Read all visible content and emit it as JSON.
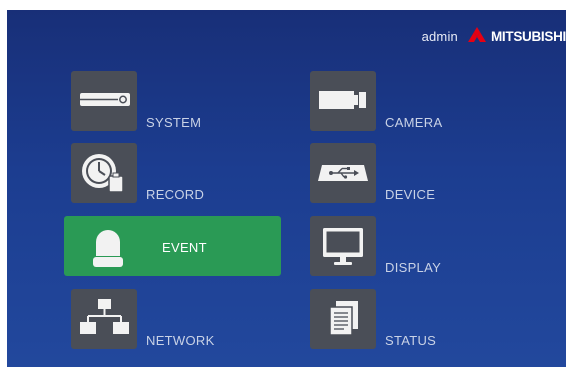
{
  "header": {
    "user": "admin",
    "brand": "MITSUBISHI",
    "brand_color": "#e60012"
  },
  "menu": {
    "system": "SYSTEM",
    "camera": "CAMERA",
    "record": "RECORD",
    "device": "DEVICE",
    "event": "EVENT",
    "display": "DISPLAY",
    "network": "NETWORK",
    "status": "STATUS",
    "selected": "event"
  },
  "icons": {
    "system": "dvr-unit-icon",
    "camera": "camera-icon",
    "record": "clock-record-icon",
    "device": "usb-device-icon",
    "event": "alarm-light-icon",
    "display": "monitor-icon",
    "network": "network-tree-icon",
    "status": "document-status-icon"
  },
  "colors": {
    "background_top": "#182f78",
    "background_bottom": "#22489d",
    "tile": "#4a4e57",
    "selected": "#2a9a55",
    "label": "#c9d2e6"
  }
}
